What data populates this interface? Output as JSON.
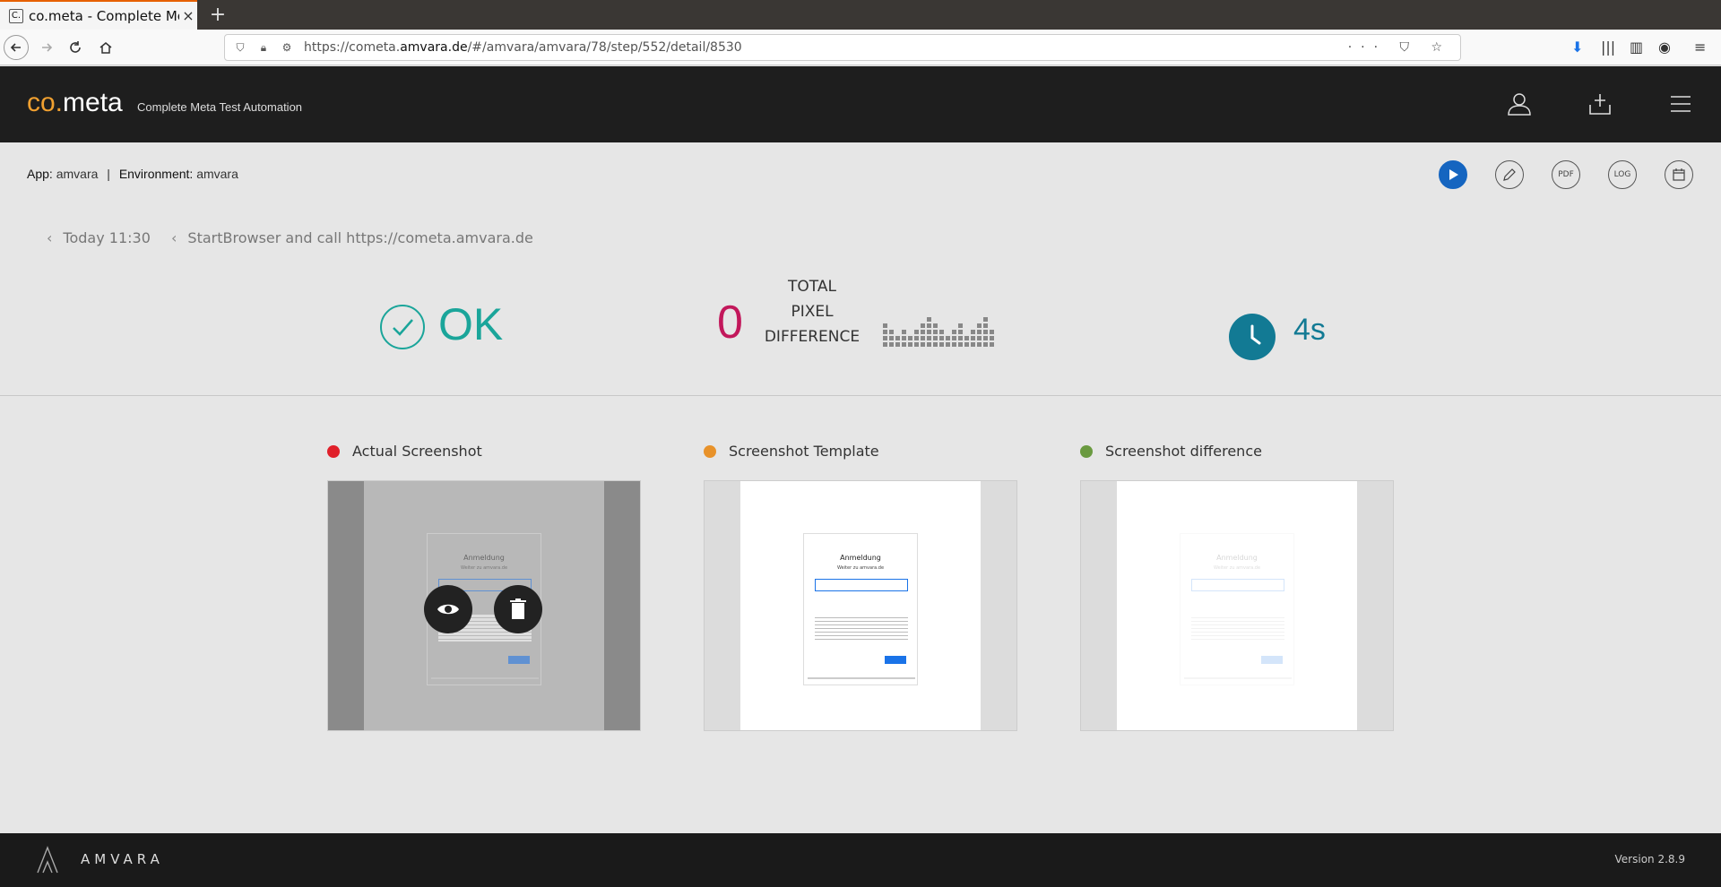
{
  "browser": {
    "tab_title": "co.meta - Complete Met",
    "tab_close": "×",
    "new_tab": "+",
    "url_prefix": "https://cometa.",
    "url_domain": "amvara.de",
    "url_path": "/#/amvara/amvara/78/step/552/detail/8530",
    "url_actions": "··· ⛉ ☆"
  },
  "header": {
    "logo_prefix": "co.",
    "logo_suffix": "meta",
    "tagline": "Complete Meta Test Automation"
  },
  "info": {
    "app_label": "App:",
    "app_value": "amvara",
    "sep": "|",
    "env_label": "Environment:",
    "env_value": "amvara"
  },
  "actions": {
    "pdf": "PDF",
    "log": "LOG"
  },
  "breadcrumb": {
    "date": "Today 11:30",
    "step": "StartBrowser and call https://cometa.amvara.de"
  },
  "stats": {
    "status": "OK",
    "pixel_diff": "0",
    "pixel_label_1": "TOTAL",
    "pixel_label_2": "PIXEL",
    "pixel_label_3": "DIFFERENCE",
    "duration": "4s"
  },
  "screenshots": [
    {
      "title": "Actual Screenshot",
      "color": "#e0202a"
    },
    {
      "title": "Screenshot Template",
      "color": "#e8922a"
    },
    {
      "title": "Screenshot difference",
      "color": "#6a9a40"
    }
  ],
  "mini_page": {
    "title": "Anmeldung",
    "subtitle": "Weiter zu amvara.de"
  },
  "footer": {
    "brand": "AMVARA",
    "version": "Version 2.8.9"
  }
}
